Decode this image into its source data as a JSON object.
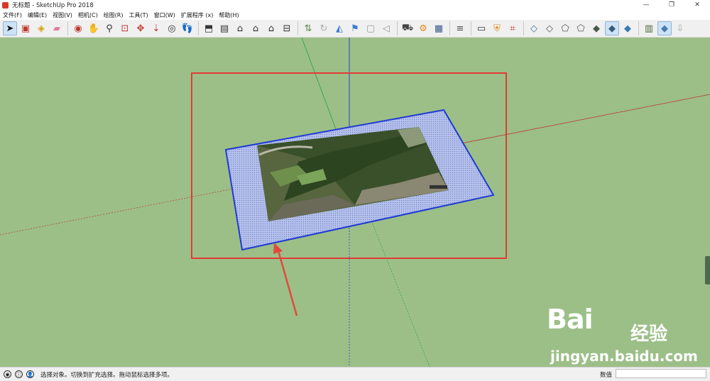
{
  "window": {
    "title": "无标题 - SketchUp Pro 2018",
    "controls": [
      "minimize-icon",
      "restore-icon",
      "close-icon"
    ]
  },
  "menu": [
    "文件(F)",
    "编辑(E)",
    "视图(V)",
    "相机(C)",
    "绘图(R)",
    "工具(T)",
    "窗口(W)",
    "扩展程序 (x)",
    "帮助(H)"
  ],
  "toolbar": {
    "groups": [
      [
        "select-arrow-icon",
        "component-icon",
        "paint-bucket-icon",
        "eraser-icon"
      ],
      [
        "orbit-icon",
        "pan-icon",
        "zoom-icon",
        "zoom-window-icon",
        "zoom-extents-icon",
        "position-camera-icon",
        "look-around-icon",
        "walk-icon"
      ],
      [
        "iso-view-icon",
        "top-view-icon",
        "front-view-icon",
        "right-view-icon",
        "back-view-icon",
        "left-view-icon"
      ],
      [
        "add-location-icon",
        "toggle-terrain-icon",
        "photo-textures-icon",
        "geo-pin-icon",
        "photo-icon",
        "sound-icon"
      ],
      [
        "warehouse-icon",
        "extension-warehouse-icon",
        "share-model-icon"
      ],
      [
        "section-settings-icon"
      ],
      [
        "layout-icon",
        "shield-icon",
        "store-icon"
      ],
      [
        "xray-icon",
        "back-edges-icon",
        "wireframe-icon",
        "hidden-line-icon",
        "shaded-icon",
        "shaded-textures-icon",
        "monochrome-icon"
      ],
      [
        "match-photo-icon",
        "texture-face-icon",
        "download-icon"
      ]
    ],
    "active": [
      "select-arrow-icon",
      "shaded-textures-icon",
      "texture-face-icon"
    ]
  },
  "status": {
    "hint": "选择对象。切换到扩充选择。拖动鼠标选择多项。",
    "measurements_label": "数值",
    "measurements_value": ""
  },
  "watermark": {
    "logo": "Bai",
    "logo_cn": "经验",
    "url": "jingyan.baidu.com"
  },
  "colors": {
    "viewport_bg": "#9cbf88",
    "selection_box": "#e53935",
    "plane_edge": "#1f3ad4",
    "plane_fill": "#a9b7e8",
    "axis_red": "#b8433a",
    "axis_green": "#2ea44a",
    "axis_blue": "#2c3fd0",
    "arrow": "#e04a3e"
  }
}
